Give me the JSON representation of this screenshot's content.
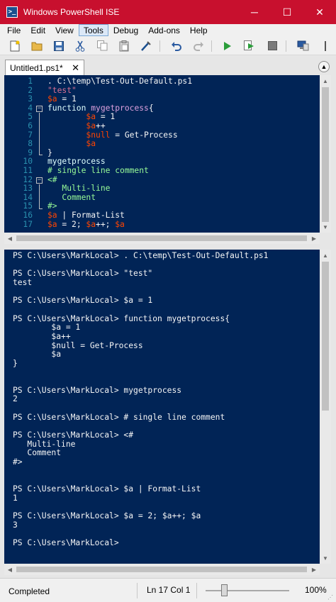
{
  "window": {
    "title": "Windows PowerShell ISE"
  },
  "menu": [
    "File",
    "Edit",
    "View",
    "Tools",
    "Debug",
    "Add-ons",
    "Help"
  ],
  "menu_active_index": 3,
  "toolbar": {
    "icons": [
      "new-icon",
      "open-icon",
      "save-icon",
      "cut-icon",
      "copy-icon",
      "paste-icon",
      "clear-console-icon",
      "undo-icon",
      "redo-icon",
      "run-script-icon",
      "run-selection-icon",
      "stop-icon",
      "new-remote-tab-icon"
    ]
  },
  "tab": {
    "label": "Untitled1.ps1*",
    "close": "✕"
  },
  "editor": {
    "lines": [
      {
        "n": "1",
        "tokens": [
          {
            "t": ". C:\\temp\\Test-Out-Default.ps1",
            "c": "def"
          }
        ]
      },
      {
        "n": "2",
        "tokens": [
          {
            "t": "\"test\"",
            "c": "str"
          }
        ]
      },
      {
        "n": "3",
        "tokens": [
          {
            "t": "$a",
            "c": "var"
          },
          {
            "t": " = 1",
            "c": "def"
          }
        ]
      },
      {
        "n": "4",
        "fold": "−",
        "tokens": [
          {
            "t": "function",
            "c": "kw"
          },
          {
            "t": " ",
            "c": "def"
          },
          {
            "t": "mygetprocess",
            "c": "fn"
          },
          {
            "t": "{",
            "c": "def"
          }
        ]
      },
      {
        "n": "5",
        "tokens": [
          {
            "t": "        ",
            "c": "def"
          },
          {
            "t": "$a",
            "c": "var"
          },
          {
            "t": " = 1",
            "c": "def"
          }
        ]
      },
      {
        "n": "6",
        "tokens": [
          {
            "t": "        ",
            "c": "def"
          },
          {
            "t": "$a",
            "c": "var"
          },
          {
            "t": "++",
            "c": "def"
          }
        ]
      },
      {
        "n": "7",
        "tokens": [
          {
            "t": "        ",
            "c": "def"
          },
          {
            "t": "$null",
            "c": "var"
          },
          {
            "t": " = Get-Process",
            "c": "def"
          }
        ]
      },
      {
        "n": "8",
        "tokens": [
          {
            "t": "        ",
            "c": "def"
          },
          {
            "t": "$a",
            "c": "var"
          }
        ]
      },
      {
        "n": "9",
        "tokens": [
          {
            "t": "}",
            "c": "def"
          }
        ]
      },
      {
        "n": "10",
        "tokens": [
          {
            "t": "mygetprocess",
            "c": "cmd"
          }
        ]
      },
      {
        "n": "11",
        "tokens": [
          {
            "t": "# single line comment",
            "c": "cmt"
          }
        ]
      },
      {
        "n": "12",
        "fold": "−",
        "tokens": [
          {
            "t": "<#",
            "c": "cmt"
          }
        ]
      },
      {
        "n": "13",
        "tokens": [
          {
            "t": "   Multi-line",
            "c": "cmt"
          }
        ]
      },
      {
        "n": "14",
        "tokens": [
          {
            "t": "   Comment",
            "c": "cmt"
          }
        ]
      },
      {
        "n": "15",
        "tokens": [
          {
            "t": "#>",
            "c": "cmt"
          }
        ]
      },
      {
        "n": "16",
        "tokens": [
          {
            "t": "$a",
            "c": "var"
          },
          {
            "t": " | Format-List",
            "c": "def"
          }
        ]
      },
      {
        "n": "17",
        "tokens": [
          {
            "t": "$a",
            "c": "var"
          },
          {
            "t": " = 2; ",
            "c": "def"
          },
          {
            "t": "$a",
            "c": "var"
          },
          {
            "t": "++; ",
            "c": "def"
          },
          {
            "t": "$a",
            "c": "var"
          }
        ]
      }
    ]
  },
  "console": {
    "lines": [
      "PS C:\\Users\\MarkLocal> . C:\\temp\\Test-Out-Default.ps1",
      "",
      "PS C:\\Users\\MarkLocal> \"test\"",
      "test",
      "",
      "PS C:\\Users\\MarkLocal> $a = 1",
      "",
      "PS C:\\Users\\MarkLocal> function mygetprocess{",
      "        $a = 1",
      "        $a++",
      "        $null = Get-Process",
      "        $a",
      "}",
      "",
      "",
      "PS C:\\Users\\MarkLocal> mygetprocess",
      "2",
      "",
      "PS C:\\Users\\MarkLocal> # single line comment",
      "",
      "PS C:\\Users\\MarkLocal> <#",
      "   Multi-line",
      "   Comment",
      "#>",
      "",
      "",
      "PS C:\\Users\\MarkLocal> $a | Format-List",
      "1",
      "",
      "PS C:\\Users\\MarkLocal> $a = 2; $a++; $a",
      "3",
      "",
      "PS C:\\Users\\MarkLocal> "
    ]
  },
  "status": {
    "text": "Completed",
    "position": "Ln 17  Col 1",
    "zoom": "100%"
  },
  "colors": {
    "pane_background": "#012456",
    "title_bar": "#c8102e",
    "variable": "#ff4500",
    "string": "#db7093",
    "keyword": "#e0ffff",
    "function_name": "#dda0dd",
    "comment": "#98fb98",
    "line_number": "#2b91af"
  }
}
